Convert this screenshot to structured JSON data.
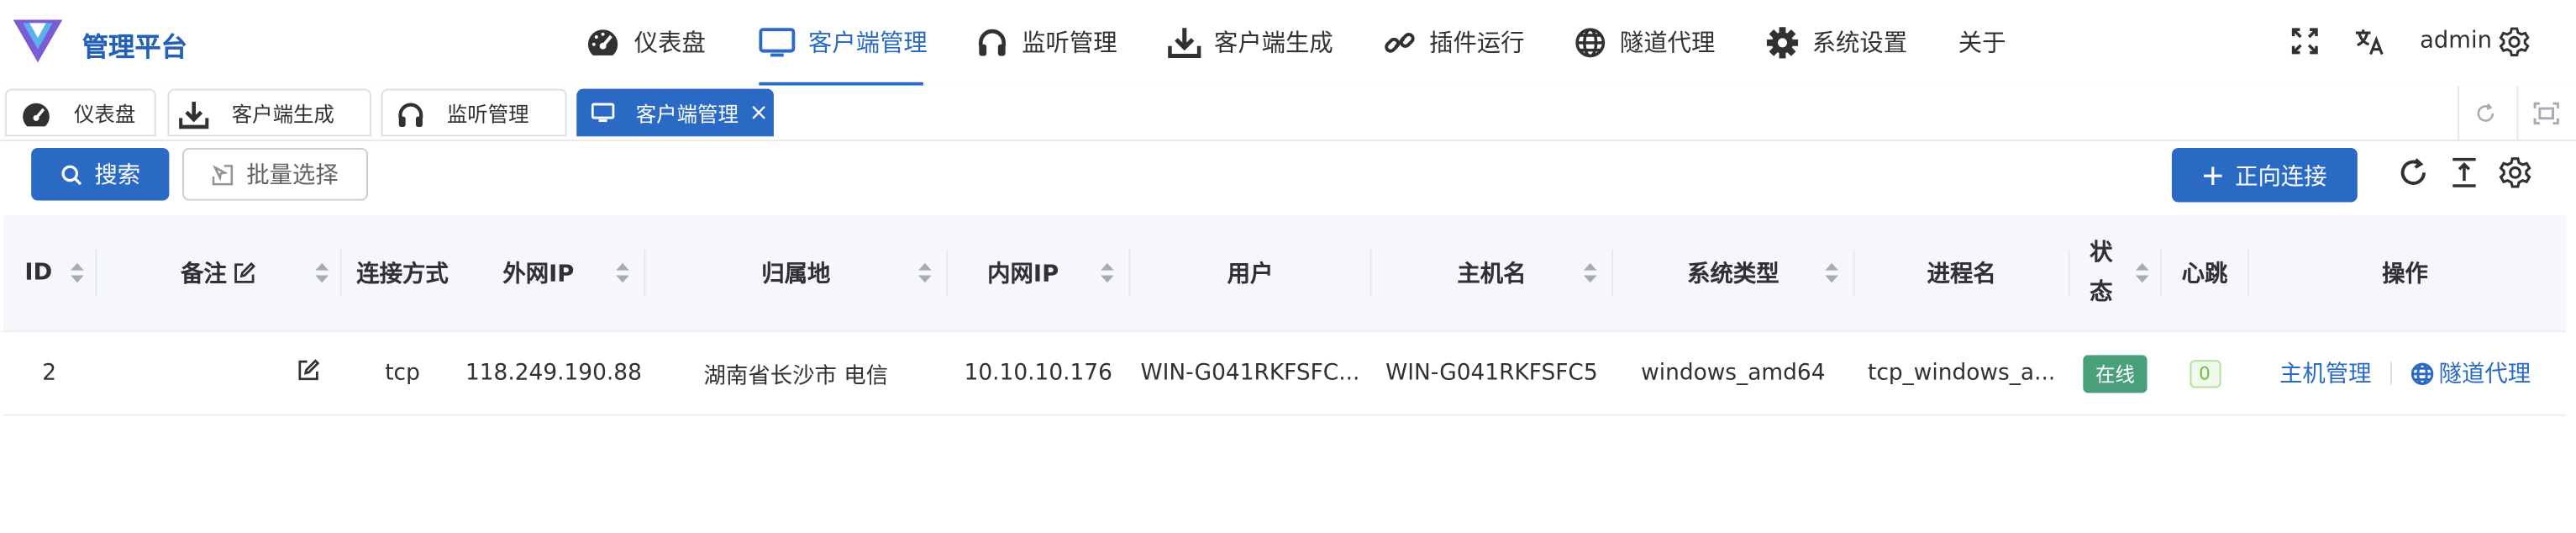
{
  "brand": {
    "title": "管理平台"
  },
  "nav": {
    "items": [
      {
        "label": "仪表盘",
        "icon": "gauge-icon"
      },
      {
        "label": "客户端管理",
        "icon": "monitor-icon"
      },
      {
        "label": "监听管理",
        "icon": "headphones-icon"
      },
      {
        "label": "客户端生成",
        "icon": "download-icon"
      },
      {
        "label": "插件运行",
        "icon": "plugin-link-icon"
      },
      {
        "label": "隧道代理",
        "icon": "globe-icon"
      },
      {
        "label": "系统设置",
        "icon": "gear-icon"
      },
      {
        "label": "关于",
        "icon": ""
      }
    ],
    "active_index": 1
  },
  "header_right": {
    "user": "admin",
    "icons": [
      "fullscreen-icon",
      "translate-icon",
      "settings-icon"
    ]
  },
  "tabs": [
    {
      "label": "仪表盘",
      "icon": "gauge-icon"
    },
    {
      "label": "客户端生成",
      "icon": "download-icon"
    },
    {
      "label": "监听管理",
      "icon": "headphones-icon"
    },
    {
      "label": "客户端管理",
      "icon": "monitor-icon",
      "active": true,
      "close": "×"
    }
  ],
  "toolbar": {
    "search_label": "搜索",
    "batch_label": "批量选择",
    "forward_label": "正向连接",
    "icons": [
      "refresh-icon",
      "column-height-icon",
      "table-settings-icon"
    ]
  },
  "table": {
    "headers": [
      "ID",
      "备注",
      "连接方式",
      "外网IP",
      "归属地",
      "内网IP",
      "用户",
      "主机名",
      "系统类型",
      "进程名",
      "状态",
      "心跳",
      "操作"
    ],
    "rows": [
      {
        "id": "2",
        "remark": "",
        "conn": "tcp",
        "wan_ip": "118.249.190.88",
        "location": "湖南省长沙市 电信",
        "lan_ip": "10.10.10.176",
        "user": "WIN-G041RKFSFC...",
        "hostname": "WIN-G041RKFSFC5",
        "os": "windows_amd64",
        "process": "tcp_windows_a...",
        "status": "在线",
        "heartbeat": "0",
        "actions": [
          "主机管理",
          "隧道代理"
        ]
      }
    ]
  },
  "colors": {
    "primary": "#2a6ac5",
    "online": "#4ba07c",
    "header_bg": "#f5f7fa"
  }
}
